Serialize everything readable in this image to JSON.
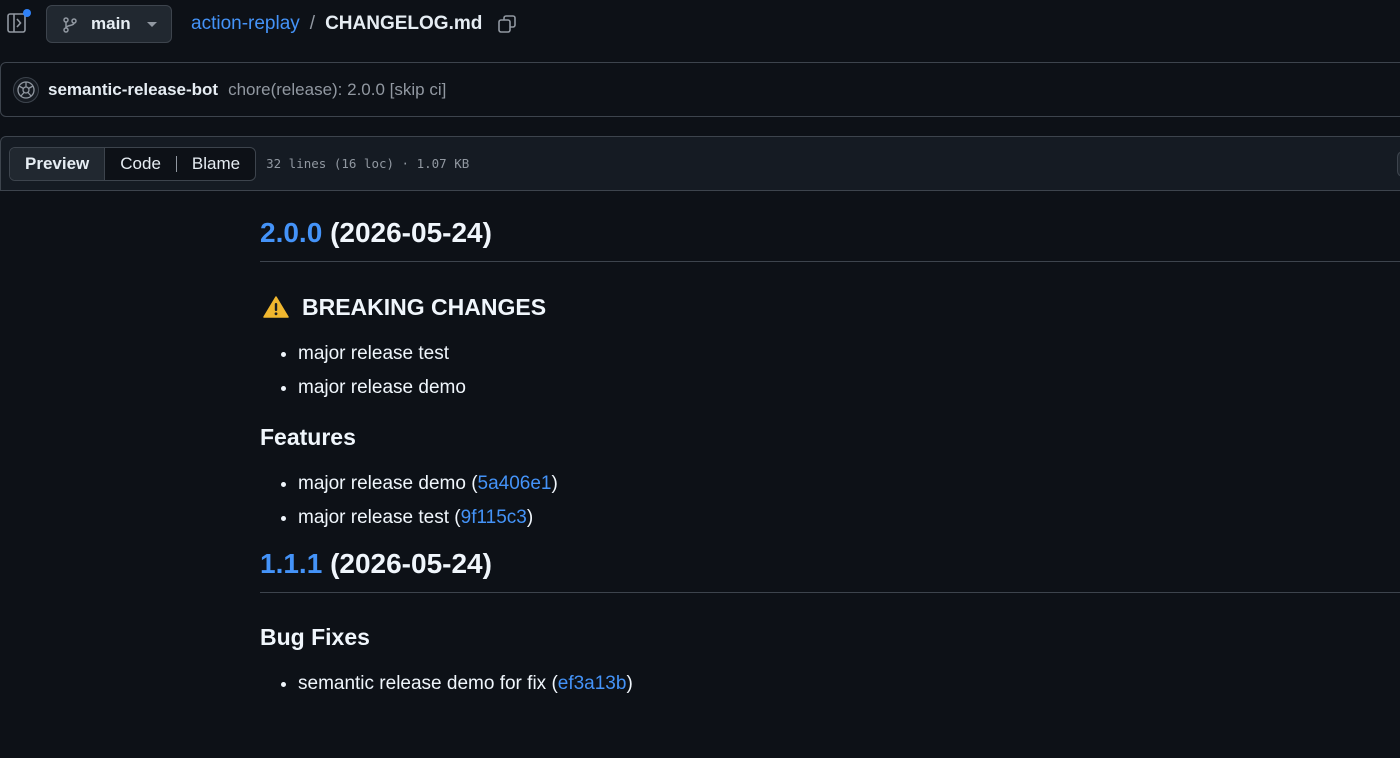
{
  "header": {
    "branch": "main",
    "repo": "action-replay",
    "separator": "/",
    "file": "CHANGELOG.md"
  },
  "commit": {
    "author": "semantic-release-bot",
    "message": "chore(release): 2.0.0 [skip ci]"
  },
  "file_header": {
    "tabs": [
      {
        "label": "Preview",
        "active": true
      },
      {
        "label": "Code",
        "active": false
      },
      {
        "label": "Blame",
        "active": false
      }
    ],
    "meta": "32 lines (16 loc) · 1.07 KB"
  },
  "content": {
    "release1": {
      "version": "2.0.0",
      "date": "(2026-05-24)",
      "breaking": {
        "title": "BREAKING CHANGES",
        "items": [
          "major release test",
          "major release demo"
        ]
      },
      "features": {
        "title": "Features",
        "items": [
          {
            "text": "major release demo (",
            "hash": "5a406e1",
            "close": ")"
          },
          {
            "text": "major release test (",
            "hash": "9f115c3",
            "close": ")"
          }
        ]
      }
    },
    "release2": {
      "version": "1.1.1",
      "date": "(2026-05-24)",
      "bugfixes": {
        "title": "Bug Fixes",
        "items": [
          {
            "text": "semantic release demo for fix (",
            "hash": "ef3a13b",
            "close": ")"
          }
        ]
      }
    }
  },
  "colors": {
    "background": "#0d1117",
    "link": "#4493f8",
    "border": "#3d444d",
    "muted": "#9198a1",
    "accent_dot": "#2f81f7",
    "warning": "#d29922"
  },
  "icons": [
    "sidebar-expand-icon",
    "git-branch-icon",
    "caret-down-icon",
    "copy-icon",
    "avatar",
    "warning-icon"
  ]
}
